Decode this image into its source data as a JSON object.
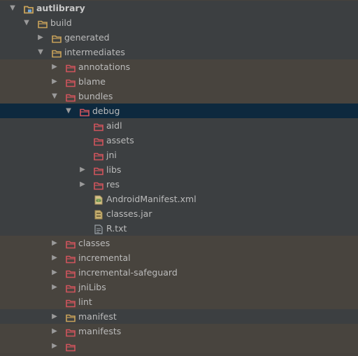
{
  "colors": {
    "folder_orange": "#c8a25a",
    "folder_red": "#d0545c",
    "selection": "#0d293e",
    "text": "#bbbbbb"
  },
  "tree": [
    {
      "label": "autlibrary",
      "icon": "module-folder-icon",
      "state": "expanded",
      "bold": true
    },
    {
      "label": "build",
      "icon": "folder-icon",
      "state": "expanded"
    },
    {
      "label": "generated",
      "icon": "folder-icon",
      "state": "collapsed"
    },
    {
      "label": "intermediates",
      "icon": "folder-icon",
      "state": "expanded"
    },
    {
      "label": "annotations",
      "icon": "excluded-folder-icon",
      "state": "collapsed"
    },
    {
      "label": "blame",
      "icon": "excluded-folder-icon",
      "state": "collapsed"
    },
    {
      "label": "bundles",
      "icon": "excluded-folder-icon",
      "state": "expanded"
    },
    {
      "label": "debug",
      "icon": "excluded-folder-icon",
      "state": "expanded",
      "selected": true
    },
    {
      "label": "aidl",
      "icon": "excluded-folder-icon",
      "state": "none"
    },
    {
      "label": "assets",
      "icon": "excluded-folder-icon",
      "state": "none"
    },
    {
      "label": "jni",
      "icon": "excluded-folder-icon",
      "state": "none"
    },
    {
      "label": "libs",
      "icon": "excluded-folder-icon",
      "state": "collapsed"
    },
    {
      "label": "res",
      "icon": "excluded-folder-icon",
      "state": "collapsed"
    },
    {
      "label": "AndroidManifest.xml",
      "icon": "manifest-file-icon",
      "state": "none"
    },
    {
      "label": "classes.jar",
      "icon": "jar-file-icon",
      "state": "none"
    },
    {
      "label": "R.txt",
      "icon": "text-file-icon",
      "state": "none"
    },
    {
      "label": "classes",
      "icon": "excluded-folder-icon",
      "state": "collapsed"
    },
    {
      "label": "incremental",
      "icon": "excluded-folder-icon",
      "state": "collapsed"
    },
    {
      "label": "incremental-safeguard",
      "icon": "excluded-folder-icon",
      "state": "collapsed"
    },
    {
      "label": "jniLibs",
      "icon": "excluded-folder-icon",
      "state": "collapsed"
    },
    {
      "label": "lint",
      "icon": "excluded-folder-icon",
      "state": "none"
    },
    {
      "label": "manifest",
      "icon": "folder-icon",
      "state": "collapsed"
    },
    {
      "label": "manifests",
      "icon": "excluded-folder-icon",
      "state": "collapsed"
    },
    {
      "label": "",
      "icon": "excluded-folder-icon",
      "state": "collapsed"
    }
  ]
}
